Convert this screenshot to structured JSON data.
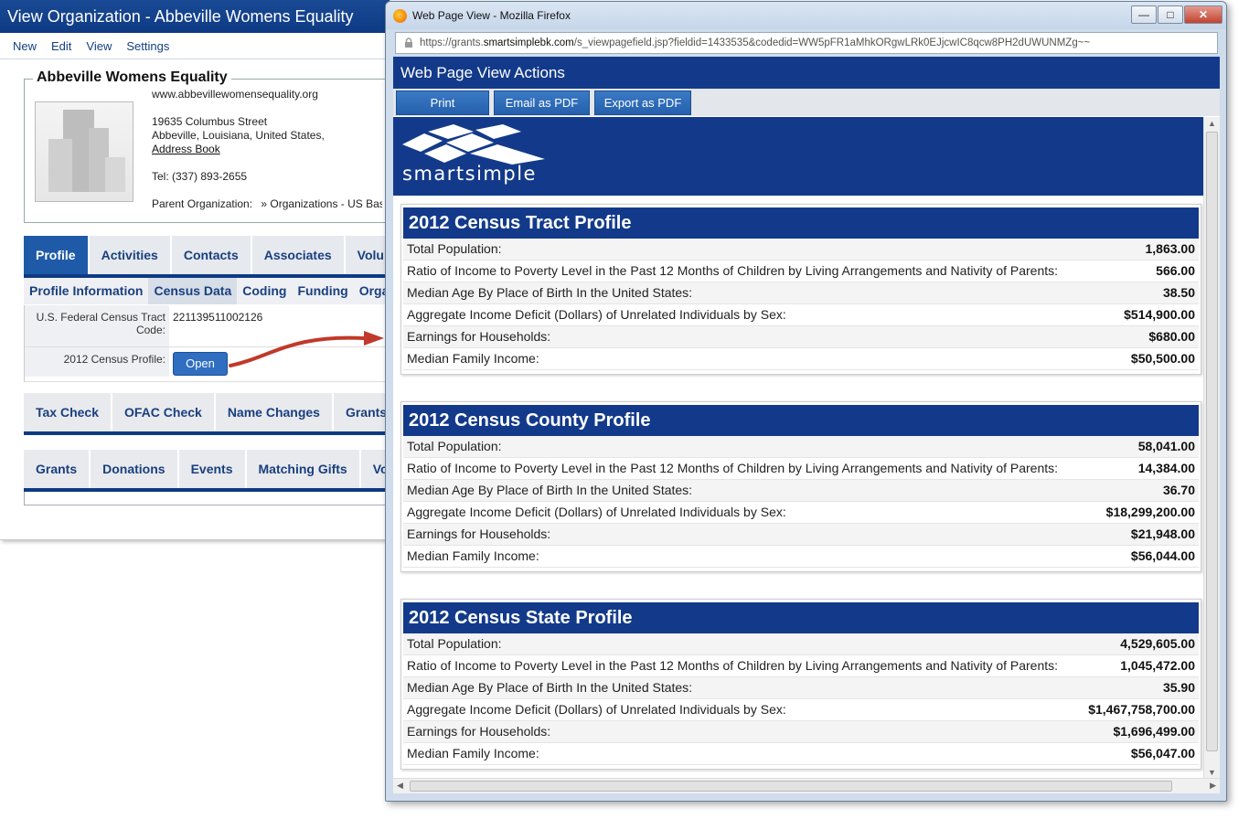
{
  "app": {
    "title": "View Organization - Abbeville Womens Equality",
    "menu": [
      "New",
      "Edit",
      "View",
      "Settings"
    ],
    "org": {
      "name": "Abbeville Womens Equality",
      "website": "www.abbevillewomensequality.org",
      "street": "19635 Columbus Street",
      "city": "Abbeville, Louisiana, United States,",
      "address_book": "Address Book",
      "tel": "Tel: (337) 893-2655",
      "parent_label": "Parent Organization:",
      "parent_value": "» Organizations - US Bas"
    },
    "tabs1": [
      "Profile",
      "Activities",
      "Contacts",
      "Associates",
      "Volunt"
    ],
    "subtabs": [
      "Profile Information",
      "Census Data",
      "Coding",
      "Funding",
      "Organi"
    ],
    "census": {
      "tract_label": "U.S. Federal Census Tract Code:",
      "tract_value": "221139511002126",
      "profile_label": "2012 Census Profile:",
      "open_button": "Open"
    },
    "tabs2": [
      "Tax Check",
      "OFAC Check",
      "Name Changes",
      "Grants ("
    ],
    "tabs3": [
      "Grants",
      "Donations",
      "Events",
      "Matching Gifts",
      "Volu"
    ]
  },
  "popup": {
    "window_title": "Web Page View - Mozilla Firefox",
    "url": "https://grants.smartsimplebk.com/s_viewpagefield.jsp?fieldid=1433535&codedid=WW5pFR1aMhkORgwLRk0EJjcwIC8qcw8PH2dUWUNMZg~~",
    "url_prefix": "https://grants.",
    "url_domain": "smartsimplebk.com",
    "url_rest": "/s_viewpagefield.jsp?fieldid=1433535&codedid=WW5pFR1aMhkORgwLRk0EJjcwIC8qcw8PH2dUWUNMZg~~",
    "window_controls": {
      "minimize": "—",
      "maximize": "□",
      "close": "✕"
    },
    "header": "Web Page View Actions",
    "buttons": {
      "print": "Print",
      "email_pdf": "Email as PDF",
      "export_pdf": "Export as PDF"
    },
    "logo_text": "smartsimple",
    "profiles": [
      {
        "title": "2012 Census Tract Profile",
        "rows": [
          {
            "label": "Total Population:",
            "value": "1,863.00"
          },
          {
            "label": "Ratio of Income to Poverty Level in the Past 12 Months of Children by Living Arrangements and Nativity of Parents:",
            "value": "566.00"
          },
          {
            "label": "Median Age By Place of Birth In the United States:",
            "value": "38.50"
          },
          {
            "label": "Aggregate Income Deficit (Dollars) of Unrelated Individuals by Sex:",
            "value": "$514,900.00"
          },
          {
            "label": "Earnings for Households:",
            "value": "$680.00"
          },
          {
            "label": "Median Family Income:",
            "value": "$50,500.00"
          }
        ]
      },
      {
        "title": "2012 Census County Profile",
        "rows": [
          {
            "label": "Total Population:",
            "value": "58,041.00"
          },
          {
            "label": "Ratio of Income to Poverty Level in the Past 12 Months of Children by Living Arrangements and Nativity of Parents:",
            "value": "14,384.00"
          },
          {
            "label": "Median Age By Place of Birth In the United States:",
            "value": "36.70"
          },
          {
            "label": "Aggregate Income Deficit (Dollars) of Unrelated Individuals by Sex:",
            "value": "$18,299,200.00"
          },
          {
            "label": "Earnings for Households:",
            "value": "$21,948.00"
          },
          {
            "label": "Median Family Income:",
            "value": "$56,044.00"
          }
        ]
      },
      {
        "title": "2012 Census State Profile",
        "rows": [
          {
            "label": "Total Population:",
            "value": "4,529,605.00"
          },
          {
            "label": "Ratio of Income to Poverty Level in the Past 12 Months of Children by Living Arrangements and Nativity of Parents:",
            "value": "1,045,472.00"
          },
          {
            "label": "Median Age By Place of Birth In the United States:",
            "value": "35.90"
          },
          {
            "label": "Aggregate Income Deficit (Dollars) of Unrelated Individuals by Sex:",
            "value": "$1,467,758,700.00"
          },
          {
            "label": "Earnings for Households:",
            "value": "$1,696,499.00"
          },
          {
            "label": "Median Family Income:",
            "value": "$56,047.00"
          }
        ]
      }
    ]
  },
  "colors": {
    "brand_navy": "#133a8a",
    "button_blue": "#2f6ec1",
    "arrow": "#c0392b"
  }
}
